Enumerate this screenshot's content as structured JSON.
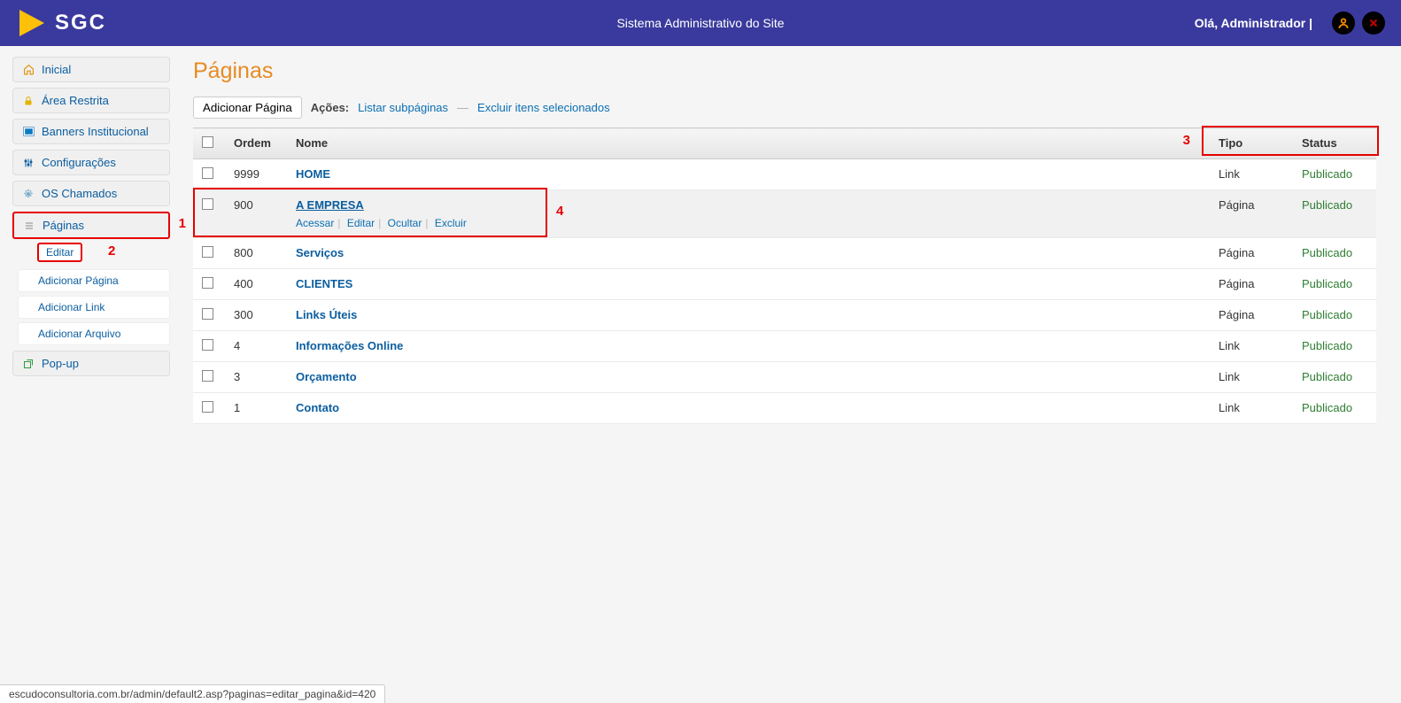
{
  "header": {
    "logo_text": "SGC",
    "subtitle": "Sistema Administrativo do Site",
    "greeting": "Olá, Administrador  |"
  },
  "sidebar": {
    "items": [
      {
        "label": "Inicial",
        "icon": "home"
      },
      {
        "label": "Área Restrita",
        "icon": "lock"
      },
      {
        "label": "Banners Institucional",
        "icon": "image"
      },
      {
        "label": "Configurações",
        "icon": "settings"
      },
      {
        "label": "OS Chamados",
        "icon": "gear-blue"
      },
      {
        "label": "Páginas",
        "icon": "list",
        "annot": "1"
      },
      {
        "label": "Pop-up",
        "icon": "popup"
      }
    ],
    "sub_paginas": [
      {
        "label": "Editar",
        "annot": "2"
      },
      {
        "label": "Adicionar Página"
      },
      {
        "label": "Adicionar Link"
      },
      {
        "label": "Adicionar Arquivo"
      }
    ]
  },
  "page": {
    "title": "Páginas",
    "add_btn": "Adicionar Página",
    "actions_label": "Ações:",
    "action_list_sub": "Listar subpáginas",
    "action_delete_sel": "Excluir itens selecionados"
  },
  "table": {
    "headers": {
      "ordem": "Ordem",
      "nome": "Nome",
      "tipo": "Tipo",
      "status": "Status"
    },
    "annot_cols": "3",
    "annot_row": "4",
    "row_actions": {
      "acessar": "Acessar",
      "editar": "Editar",
      "ocultar": "Ocultar",
      "excluir": "Excluir"
    },
    "rows": [
      {
        "ordem": "9999",
        "nome": "HOME",
        "tipo": "Link",
        "status": "Publicado"
      },
      {
        "ordem": "900",
        "nome": "A EMPRESA",
        "tipo": "Página",
        "status": "Publicado",
        "hovered": true
      },
      {
        "ordem": "800",
        "nome": "Serviços",
        "tipo": "Página",
        "status": "Publicado"
      },
      {
        "ordem": "400",
        "nome": "CLIENTES",
        "tipo": "Página",
        "status": "Publicado"
      },
      {
        "ordem": "300",
        "nome": "Links Úteis",
        "tipo": "Página",
        "status": "Publicado"
      },
      {
        "ordem": "4",
        "nome": "Informações Online",
        "tipo": "Link",
        "status": "Publicado"
      },
      {
        "ordem": "3",
        "nome": "Orçamento",
        "tipo": "Link",
        "status": "Publicado"
      },
      {
        "ordem": "1",
        "nome": "Contato",
        "tipo": "Link",
        "status": "Publicado"
      }
    ]
  },
  "status_bar": "escudoconsultoria.com.br/admin/default2.asp?paginas=editar_pagina&id=420"
}
